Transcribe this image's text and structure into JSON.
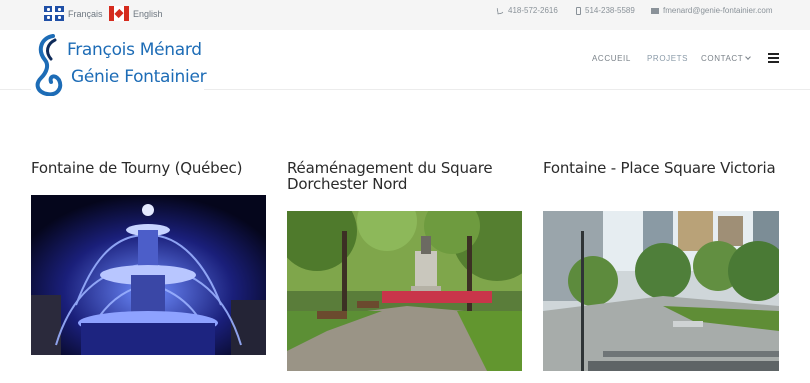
{
  "topbar": {
    "languages": [
      {
        "label": "Français"
      },
      {
        "label": "English"
      }
    ],
    "phone1": "418-572-2616",
    "phone2": "514-238-5589",
    "email": "fmenard@genie-fontainier.com"
  },
  "logo": {
    "line1": "François Ménard",
    "line2": "Génie Fontainier"
  },
  "nav": {
    "items": [
      {
        "label": "ACCUEIL"
      },
      {
        "label": "PROJETS"
      },
      {
        "label": "CONTACT"
      }
    ]
  },
  "projects": [
    {
      "title": "Fontaine de Tourny (Québec)"
    },
    {
      "title": "Réaménagement du Square Dorchester Nord"
    },
    {
      "title": "Fontaine - Place Square Victoria"
    }
  ],
  "colors": {
    "brand_blue": "#1d6cb6",
    "topbar_bg": "#f5f5f5",
    "text_dark": "#2b2b2b",
    "nav_text": "#7a8289"
  },
  "icons": [
    "quebec-flag-icon",
    "canada-flag-icon",
    "phone-icon",
    "mobile-icon",
    "envelope-icon",
    "chevron-down-icon",
    "hamburger-menu-icon"
  ]
}
